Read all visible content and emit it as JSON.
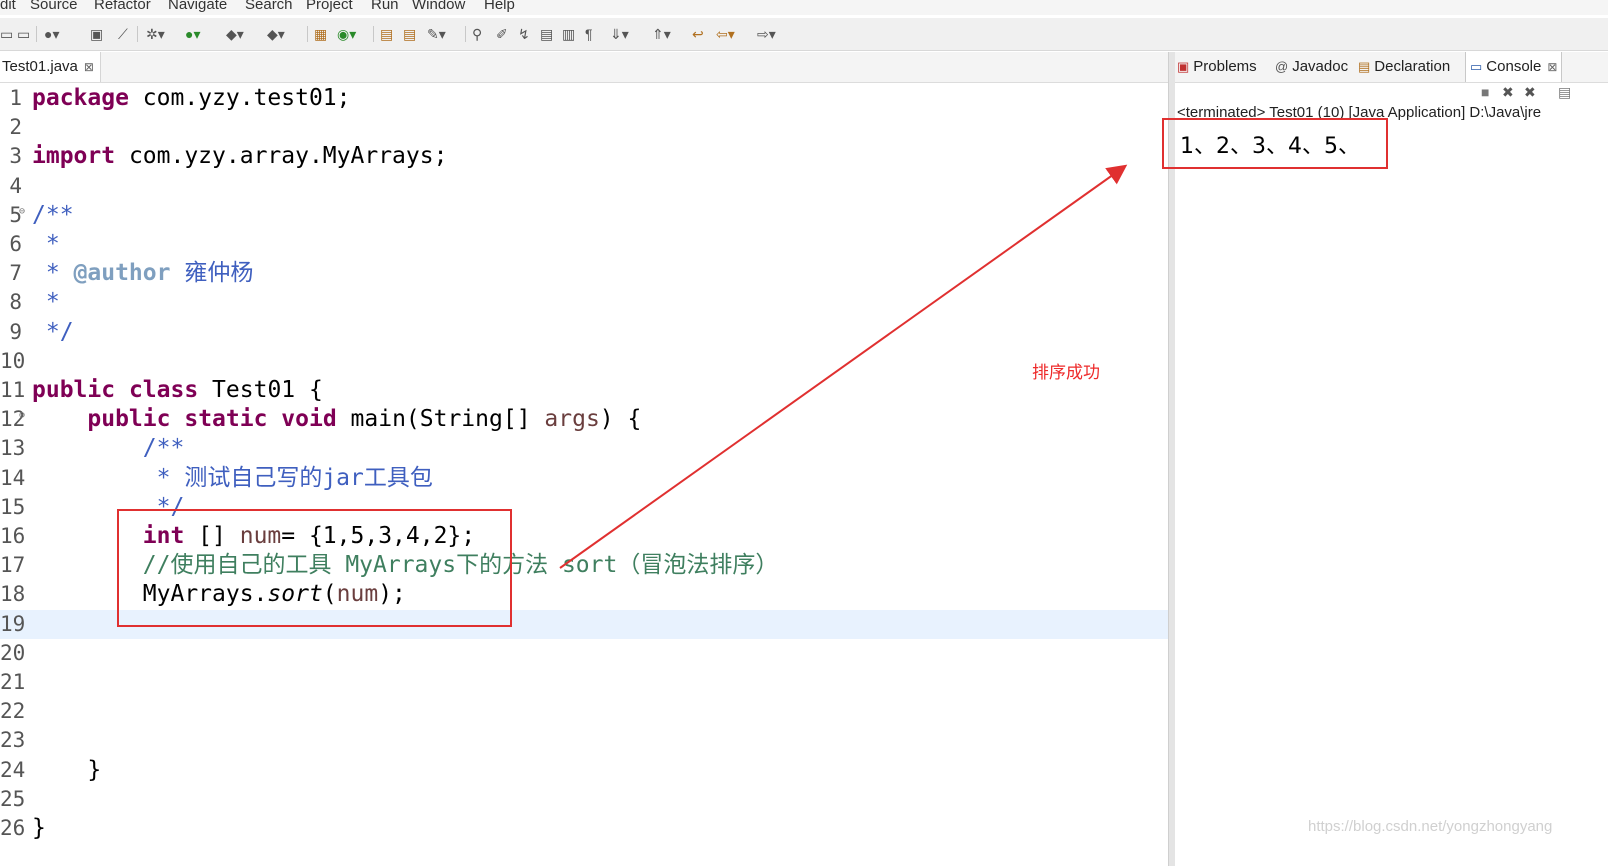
{
  "menu": [
    "dit",
    "Source",
    "Refactor",
    "Navigate",
    "Search",
    "Project",
    "Run",
    "Window",
    "Help"
  ],
  "editor_tab": {
    "title": "Test01.java",
    "close": "⊠"
  },
  "code_lines": [
    {
      "n": "1",
      "parts": [
        {
          "t": "package",
          "c": "kw"
        },
        {
          "t": " com.yzy.test01;",
          "c": ""
        }
      ]
    },
    {
      "n": "2",
      "parts": []
    },
    {
      "n": "3",
      "parts": [
        {
          "t": "import",
          "c": "kw"
        },
        {
          "t": " com.yzy.array.MyArrays;",
          "c": ""
        }
      ]
    },
    {
      "n": "4",
      "parts": []
    },
    {
      "n": "5",
      "fold": true,
      "parts": [
        {
          "t": "/**",
          "c": "jd"
        }
      ]
    },
    {
      "n": "6",
      "parts": [
        {
          "t": " *",
          "c": "jd"
        }
      ]
    },
    {
      "n": "7",
      "parts": [
        {
          "t": " * ",
          "c": "jd"
        },
        {
          "t": "@author",
          "c": "jdtag"
        },
        {
          "t": " 雍仲杨",
          "c": "jd"
        }
      ]
    },
    {
      "n": "8",
      "parts": [
        {
          "t": " *",
          "c": "jd"
        }
      ]
    },
    {
      "n": "9",
      "parts": [
        {
          "t": " */",
          "c": "jd"
        }
      ]
    },
    {
      "n": "10",
      "parts": []
    },
    {
      "n": "11",
      "parts": [
        {
          "t": "public",
          "c": "kw"
        },
        {
          "t": " ",
          "c": ""
        },
        {
          "t": "class",
          "c": "kw"
        },
        {
          "t": " Test01 {",
          "c": ""
        }
      ]
    },
    {
      "n": "12",
      "fold": true,
      "parts": [
        {
          "t": "    ",
          "c": ""
        },
        {
          "t": "public",
          "c": "kw"
        },
        {
          "t": " ",
          "c": ""
        },
        {
          "t": "static",
          "c": "kw"
        },
        {
          "t": " ",
          "c": ""
        },
        {
          "t": "void",
          "c": "kw"
        },
        {
          "t": " main(String[] ",
          "c": ""
        },
        {
          "t": "args",
          "c": "vr"
        },
        {
          "t": ") {",
          "c": ""
        }
      ]
    },
    {
      "n": "13",
      "parts": [
        {
          "t": "        /**",
          "c": "jd"
        }
      ]
    },
    {
      "n": "14",
      "parts": [
        {
          "t": "         * 测试自己写的jar工具包",
          "c": "jd"
        }
      ]
    },
    {
      "n": "15",
      "parts": [
        {
          "t": "         */",
          "c": "jd"
        }
      ]
    },
    {
      "n": "16",
      "parts": [
        {
          "t": "        ",
          "c": ""
        },
        {
          "t": "int",
          "c": "kw"
        },
        {
          "t": " [] ",
          "c": ""
        },
        {
          "t": "num",
          "c": "vr"
        },
        {
          "t": "= {1,5,3,4,2};",
          "c": ""
        }
      ]
    },
    {
      "n": "17",
      "parts": [
        {
          "t": "        //使用自己的工具 MyArrays下的方法 sort（冒泡法排序）",
          "c": "cm"
        }
      ]
    },
    {
      "n": "18",
      "parts": [
        {
          "t": "        MyArrays.",
          "c": ""
        },
        {
          "t": "sort",
          "c": "it"
        },
        {
          "t": "(",
          "c": ""
        },
        {
          "t": "num",
          "c": "vr"
        },
        {
          "t": ");",
          "c": ""
        }
      ]
    },
    {
      "n": "19",
      "current": true,
      "parts": []
    },
    {
      "n": "20",
      "parts": []
    },
    {
      "n": "21",
      "parts": []
    },
    {
      "n": "22",
      "parts": []
    },
    {
      "n": "23",
      "parts": []
    },
    {
      "n": "24",
      "parts": [
        {
          "t": "    }",
          "c": ""
        }
      ]
    },
    {
      "n": "25",
      "parts": []
    },
    {
      "n": "26",
      "parts": [
        {
          "t": "}",
          "c": ""
        }
      ]
    }
  ],
  "views": {
    "problems": "Problems",
    "javadoc": "Javadoc",
    "declaration": "Declaration",
    "console": "Console"
  },
  "console": {
    "terminated": "<terminated> Test01 (10) [Java Application] D:\\Java\\jre",
    "output": "1、2、3、4、5、"
  },
  "annotation": "排序成功",
  "watermark": "https://blog.csdn.net/yongzhongyang",
  "colors": {
    "keyword": "#7f0055",
    "javadoc": "#3f5fbf",
    "comment": "#3f7f5f",
    "annotation_red": "#e03030"
  }
}
